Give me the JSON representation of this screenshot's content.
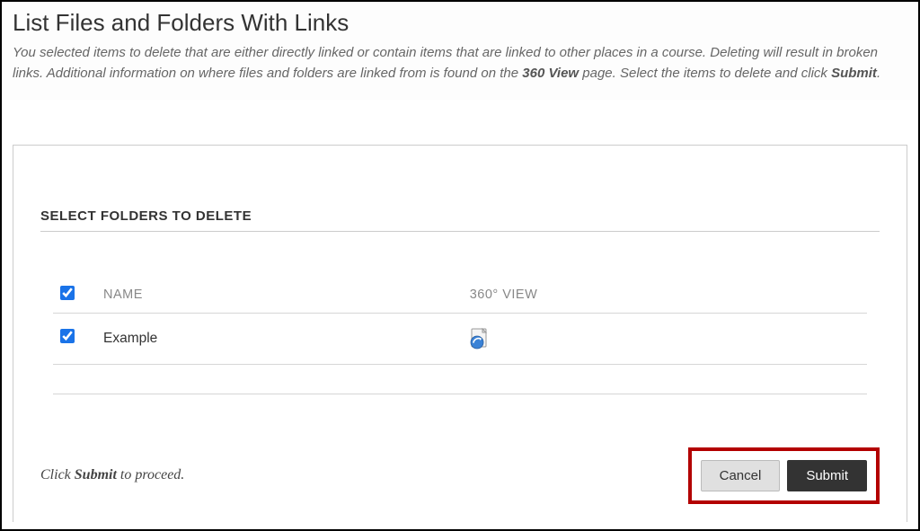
{
  "header": {
    "title": "List Files and Folders With Links",
    "desc_part1": "You selected items to delete that are either directly linked or contain items that are linked to other places in a course. Deleting will result in broken links. Additional information on where files and folders are linked from is found on the ",
    "desc_bold1": "360 View",
    "desc_part2": " page. Select the items to delete and click ",
    "desc_bold2": "Submit",
    "desc_part3": "."
  },
  "section": {
    "heading": "SELECT FOLDERS TO DELETE"
  },
  "table": {
    "col_name": "NAME",
    "col_view": "360° VIEW",
    "rows": [
      {
        "name": "Example",
        "checked": true
      }
    ]
  },
  "footer": {
    "text_pre": "Click ",
    "text_bold": "Submit",
    "text_post": " to proceed."
  },
  "buttons": {
    "cancel": "Cancel",
    "submit": "Submit"
  }
}
